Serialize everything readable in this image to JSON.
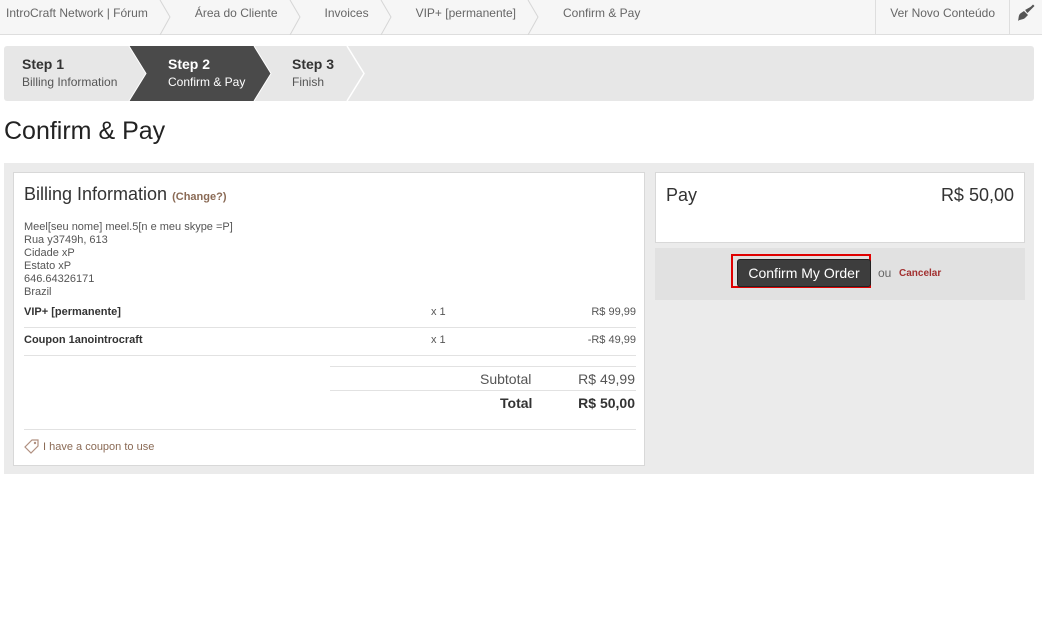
{
  "breadcrumbs": [
    {
      "label": "IntroCraft Network | Fórum"
    },
    {
      "label": "Área do Cliente"
    },
    {
      "label": "Invoices"
    },
    {
      "label": "VIP+ [permanente]"
    },
    {
      "label": "Confirm & Pay"
    }
  ],
  "topbar": {
    "new_content_label": "Ver Novo Conteúdo",
    "theme_icon": "brush-icon"
  },
  "steps": [
    {
      "title": "Step 1",
      "subtitle": "Billing Information",
      "active": false
    },
    {
      "title": "Step 2",
      "subtitle": "Confirm & Pay",
      "active": true
    },
    {
      "title": "Step 3",
      "subtitle": "Finish",
      "active": false
    }
  ],
  "page": {
    "title": "Confirm & Pay"
  },
  "billing": {
    "title": "Billing Information",
    "change_label": "(Change?)",
    "address_lines": [
      "Meel[seu nome] meel.5[n e meu skype =P]",
      "Rua y3749h, 613",
      "Cidade xP",
      "Estato xP",
      "646.64326171",
      "Brazil"
    ],
    "items": [
      {
        "name": "VIP+ [permanente]",
        "qty": "x 1",
        "price": "R$ 99,99"
      },
      {
        "name": "Coupon 1anointrocraft",
        "qty": "x 1",
        "price": "-R$ 49,99"
      }
    ],
    "subtotal_label": "Subtotal",
    "subtotal_value": "R$ 49,99",
    "total_label": "Total",
    "total_value": "R$ 50,00",
    "coupon_link": "I have a coupon to use"
  },
  "pay": {
    "label": "Pay",
    "amount": "R$ 50,00",
    "confirm_button": "Confirm My Order",
    "or_text": "ou",
    "cancel_label": "Cancelar"
  },
  "colors": {
    "active_step": "#4a4a4a",
    "highlight": "#e00000",
    "link": "#8a6a55",
    "cancel": "#a23030"
  }
}
